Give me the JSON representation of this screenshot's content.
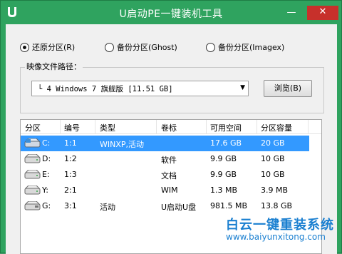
{
  "window": {
    "title": "U启动PE一键装机工具",
    "minimize_glyph": "—",
    "close_glyph": "✕"
  },
  "radios": [
    {
      "label": "还原分区(R)",
      "checked": true
    },
    {
      "label": "备份分区(Ghost)",
      "checked": false
    },
    {
      "label": "备份分区(Imagex)",
      "checked": false
    }
  ],
  "image_path": {
    "group_label": "映像文件路径：",
    "value": "└  4 Windows 7 旗舰版 [11.51 GB]",
    "browse_label": "浏览(B)"
  },
  "table": {
    "columns": [
      "分区",
      "编号",
      "类型",
      "卷标",
      "可用空间",
      "分区容量"
    ],
    "rows": [
      {
        "part": "C:",
        "num": "1:1",
        "type": "WINXP,活动",
        "label": "",
        "free": "17.6 GB",
        "size": "20 GB",
        "selected": true
      },
      {
        "part": "D:",
        "num": "1:2",
        "type": "",
        "label": "软件",
        "free": "9.9 GB",
        "size": "10 GB",
        "selected": false
      },
      {
        "part": "E:",
        "num": "1:3",
        "type": "",
        "label": "文档",
        "free": "9.9 GB",
        "size": "10 GB",
        "selected": false
      },
      {
        "part": "Y:",
        "num": "2:1",
        "type": "",
        "label": "WIM",
        "free": "1.3 MB",
        "size": "3.9 MB",
        "selected": false
      },
      {
        "part": "G:",
        "num": "3:1",
        "type": "活动",
        "label": "U启动U盘",
        "free": "981.5 MB",
        "size": "13.8 GB",
        "selected": false
      }
    ]
  },
  "watermark": {
    "brand": "白云一键重装系统",
    "url": "www.baiyunxitong.com"
  },
  "colors": {
    "titlebar": "#2fa35f",
    "selection": "#3399ff",
    "close": "#c7302b"
  }
}
